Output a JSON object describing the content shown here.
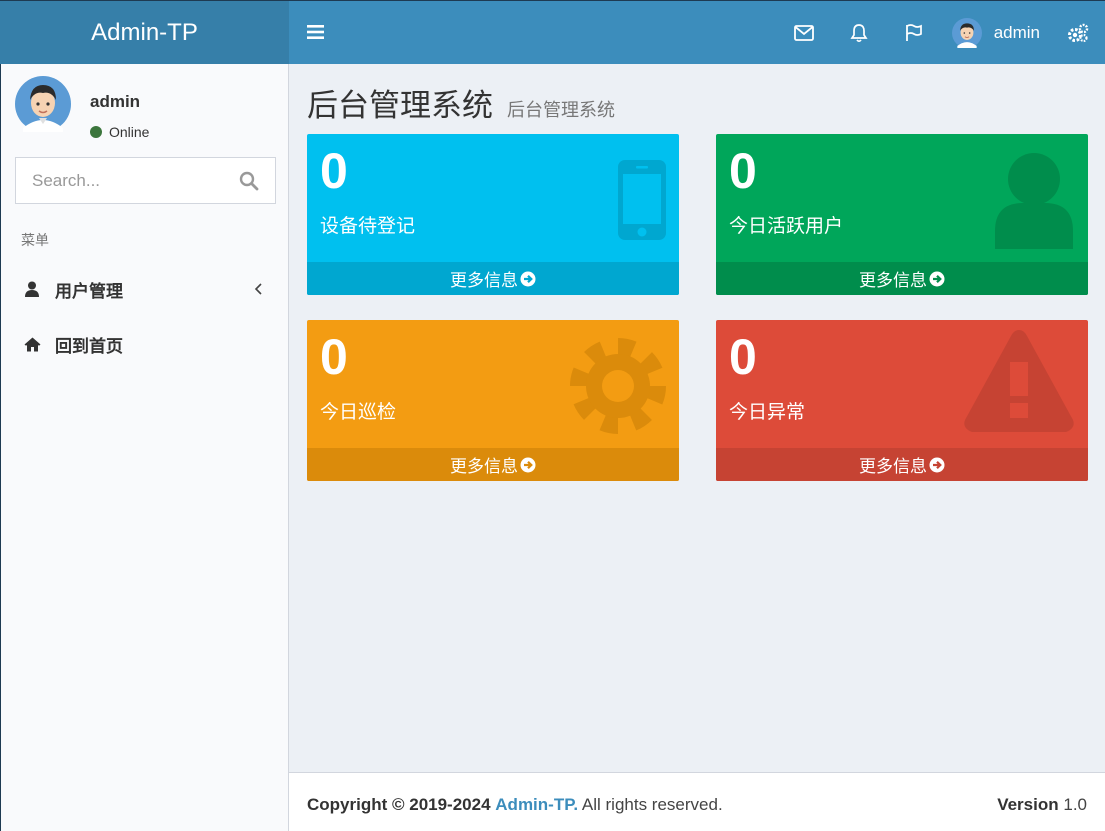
{
  "header": {
    "logo": "Admin-TP",
    "username": "admin"
  },
  "sidebar": {
    "user": {
      "name": "admin",
      "status": "Online"
    },
    "search": {
      "placeholder": "Search..."
    },
    "menu_header": "菜单",
    "items": [
      {
        "label": "用户管理",
        "icon": "user-icon",
        "has_submenu": true
      },
      {
        "label": "回到首页",
        "icon": "home-icon",
        "has_submenu": false
      }
    ]
  },
  "content": {
    "title": "后台管理系统",
    "subtitle": "后台管理系统",
    "boxes": [
      {
        "value": "0",
        "label": "设备待登记",
        "more": "更多信息",
        "color": "#00c0ef",
        "icon": "mobile-icon"
      },
      {
        "value": "0",
        "label": "今日活跃用户",
        "more": "更多信息",
        "color": "#00a65a",
        "icon": "user-icon"
      },
      {
        "value": "0",
        "label": "今日巡检",
        "more": "更多信息",
        "color": "#f39c12",
        "icon": "gear-icon"
      },
      {
        "value": "0",
        "label": "今日异常",
        "more": "更多信息",
        "color": "#dd4b39",
        "icon": "warning-icon"
      }
    ]
  },
  "footer": {
    "copyright_prefix": "Copyright © 2019-2024",
    "brand": "Admin-TP.",
    "rights": "All rights reserved.",
    "version_label": "Version",
    "version": "1.0"
  },
  "colors": {
    "header": "#3c8dbc",
    "logo_bg": "#367fa9",
    "content_bg": "#ecf0f5"
  }
}
